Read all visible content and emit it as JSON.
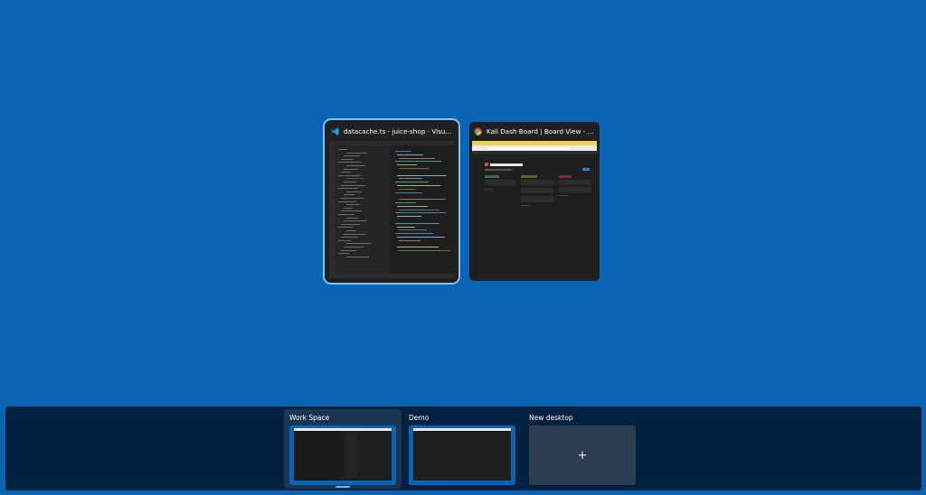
{
  "windows": [
    {
      "title": "datacache.ts - juice-shop - Visual Studi...",
      "app_icon": "vscode-icon",
      "selected": true
    },
    {
      "title": "Kali Dash Board | Board View - Google...",
      "app_icon": "chrome-icon",
      "selected": false
    }
  ],
  "desktops": {
    "items": [
      {
        "label": "Work Space",
        "active": true
      },
      {
        "label": "Demo",
        "active": false
      }
    ],
    "new_desktop_label": "New desktop",
    "new_desktop_icon": "+"
  },
  "colors": {
    "background": "#0a64b4",
    "selection_ring": "#7cc2f5",
    "desktop_bar": "#002140"
  }
}
